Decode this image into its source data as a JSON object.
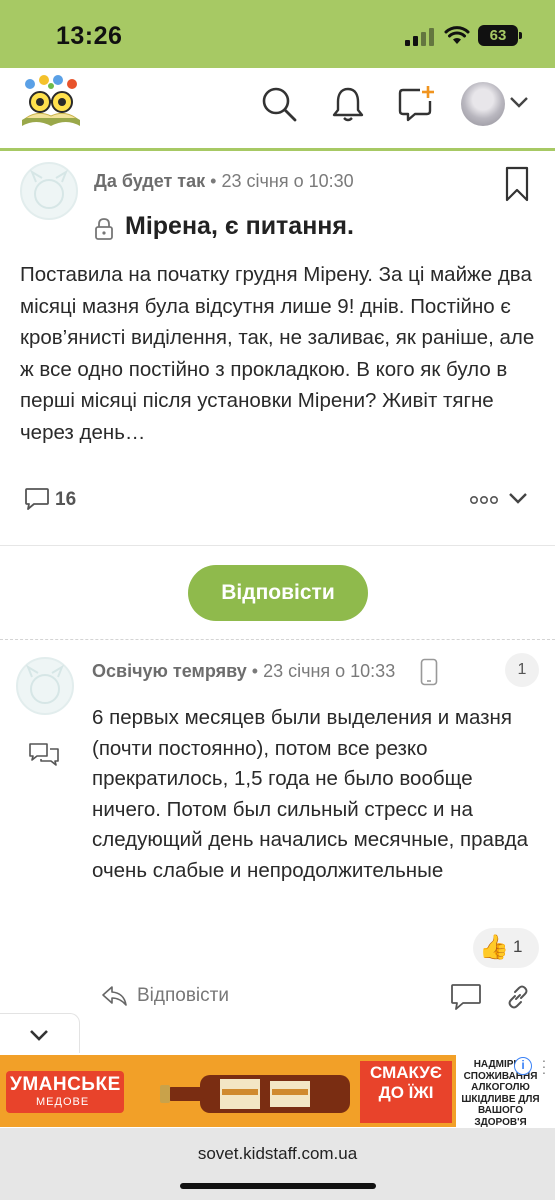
{
  "status_bar": {
    "time": "13:26",
    "battery": "63"
  },
  "header": {
    "logo_icon": "kidstaff-logo-icon",
    "search_icon": "search-icon",
    "notifications_icon": "bell-icon",
    "new_post_icon": "new-post-icon",
    "avatar_icon": "user-avatar",
    "menu_icon": "chevron-down-icon",
    "accent_color": "#a7c964"
  },
  "post": {
    "author": "Да будет так",
    "separator": "•",
    "date": "23 січня о 10:30",
    "title": "Мірена, є питання.",
    "body": "Поставила на початку грудня Мірену. За ці майже два місяці мазня була відсутня лише 9! днів. Постійно є кров’янисті виділення, так, не заливає, як раніше, але ж все одно постійно з прокладкою. В кого як було в перші місяці після установки Мірени? Живіт тягне через день…",
    "comments_count": "16"
  },
  "reply_button": {
    "label": "Відповісти",
    "color": "#8fba4c"
  },
  "comment": {
    "author": "Освічую темряву",
    "separator": "•",
    "date": "23 січня о 10:33",
    "number": "1",
    "body": "6 первых месяцев были выделения и мазня (почти постоянно), потом все резко прекратилось, 1,5 года не было вообще ничего. Потом был сильный стресс и на следующий день начались месячные, правда очень слабые и непродолжительные",
    "like_emoji": "👍",
    "likes": "1",
    "reply_label": "Відповісти"
  },
  "ad": {
    "brand": "УМАНСЬКЕ",
    "brand_sub": "МЕДОВЕ",
    "tagline": "СМАКУЄ ДО ЇЖІ",
    "warning": "НАДМІРНЕ СПОЖИВАННЯ АЛКОГОЛЮ ШКІДЛИВЕ ДЛЯ ВАШОГО ЗДОРОВ'Я",
    "info": "i",
    "color": "#f2a028"
  },
  "browser": {
    "url": "sovet.kidstaff.com.ua"
  }
}
